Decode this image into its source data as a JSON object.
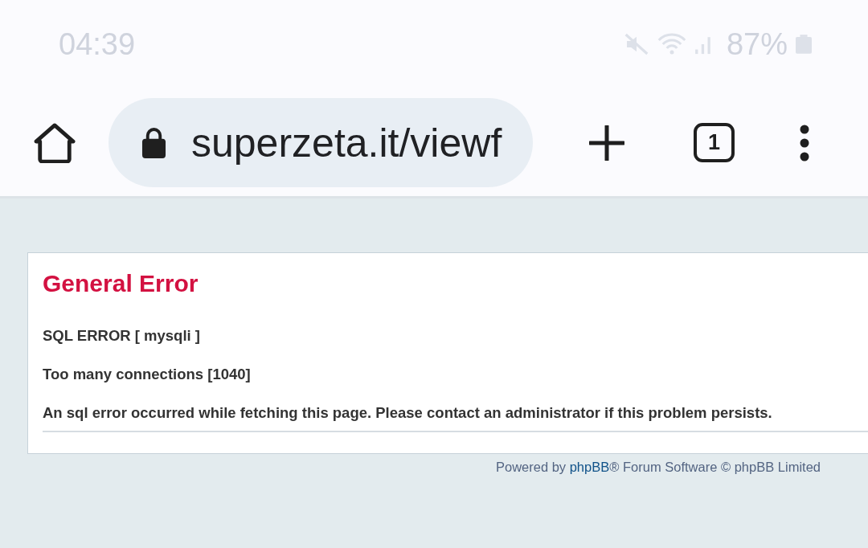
{
  "status_bar": {
    "time": "04:39",
    "battery": "87%"
  },
  "toolbar": {
    "url": "superzeta.it/viewf",
    "tab_count": "1"
  },
  "error_panel": {
    "title": "General Error",
    "lines": [
      "SQL ERROR [ mysqli ]",
      "Too many connections [1040]",
      "An sql error occurred while fetching this page. Please contact an administrator if this problem persists."
    ]
  },
  "footer": {
    "before": "Powered by",
    "link": "phpBB",
    "after": "® Forum Software © phpBB Limited"
  }
}
